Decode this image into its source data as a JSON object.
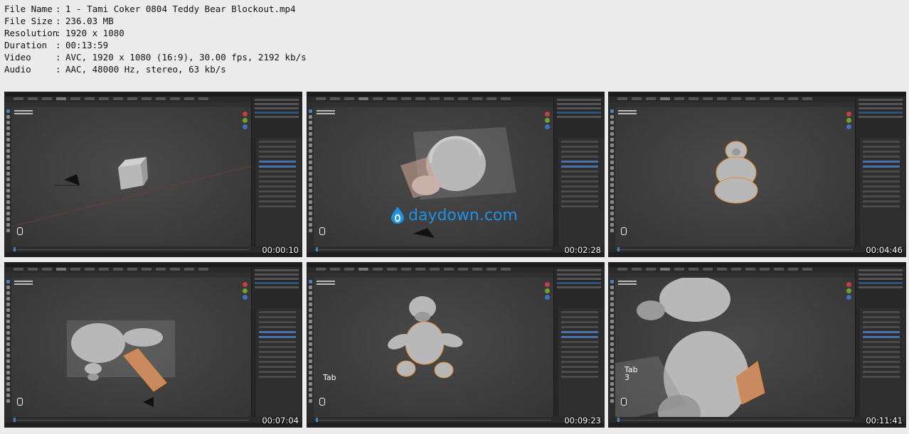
{
  "file_info": [
    {
      "key": "File Name",
      "sep": ":",
      "value": "1 - Tami Coker 0804 Teddy Bear Blockout.mp4"
    },
    {
      "key": "File Size",
      "sep": ":",
      "value": "236.03 MB"
    },
    {
      "key": "Resolution",
      "sep": ":",
      "value": "1920 x 1080"
    },
    {
      "key": "Duration",
      "sep": ":",
      "value": "00:13:59"
    },
    {
      "key": "Video",
      "sep": ":",
      "value": "AVC, 1920 x 1080 (16:9), 30.00 fps, 2192 kb/s"
    },
    {
      "key": "Audio",
      "sep": ":",
      "value": "AAC, 48000 Hz, stereo, 63 kb/s"
    }
  ],
  "thumbnails": [
    {
      "timestamp": "00:00:10",
      "scene": "cube",
      "keycast": ""
    },
    {
      "timestamp": "00:02:28",
      "scene": "head",
      "keycast": ""
    },
    {
      "timestamp": "00:04:46",
      "scene": "snowman",
      "keycast": ""
    },
    {
      "timestamp": "00:07:04",
      "scene": "head-side",
      "keycast": ""
    },
    {
      "timestamp": "00:09:23",
      "scene": "bear",
      "keycast": "Tab"
    },
    {
      "timestamp": "00:11:41",
      "scene": "closeup",
      "keycast": "Tab\n3"
    }
  ],
  "watermark": {
    "text": "daydown.com",
    "color": "#1e90e6"
  },
  "colors": {
    "background": "#ececec",
    "viewport": "#3d3d3d",
    "selection_outline": "#e08a2a",
    "accent": "#4a7fc0"
  }
}
